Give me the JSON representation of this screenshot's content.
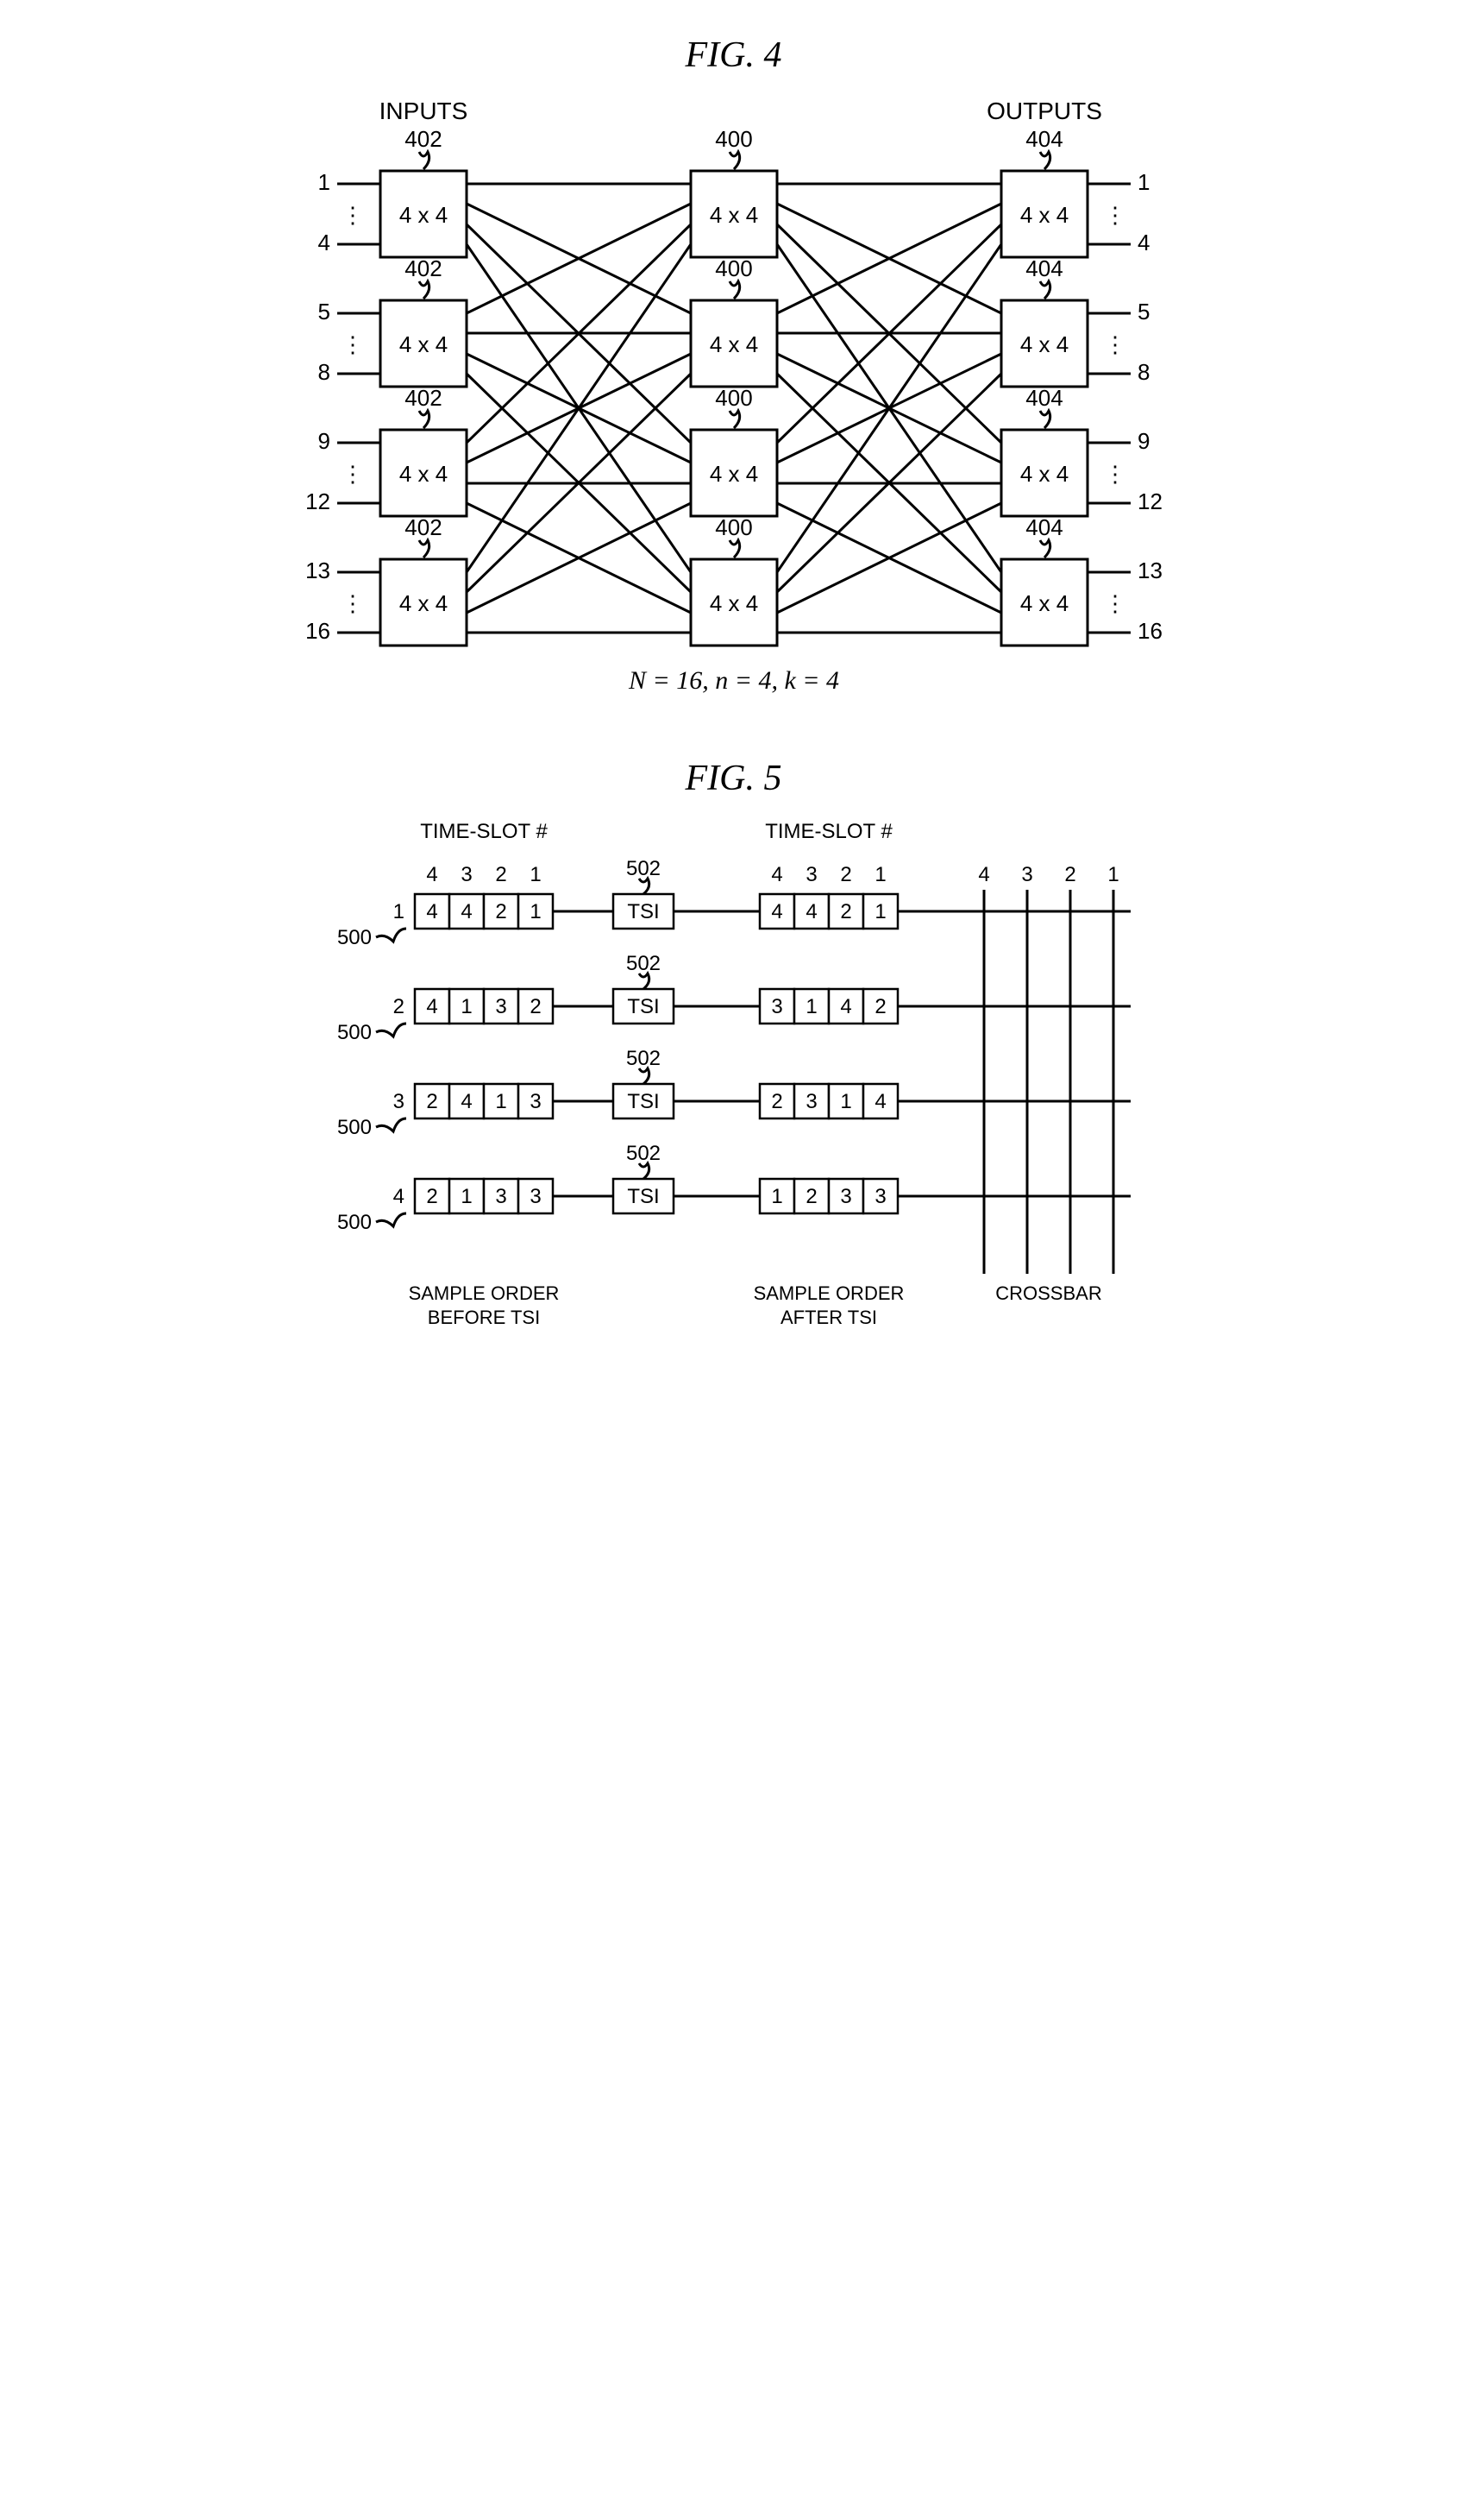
{
  "fig4": {
    "title": "FIG. 4",
    "inputs_label": "INPUTS",
    "outputs_label": "OUTPUTS",
    "ref_input": "402",
    "ref_middle": "400",
    "ref_output": "404",
    "box_label": "4 x 4",
    "caption": "N = 16,   n = 4,   k = 4",
    "left_ports": [
      {
        "top": "1",
        "bot": "4"
      },
      {
        "top": "5",
        "bot": "8"
      },
      {
        "top": "9",
        "bot": "12"
      },
      {
        "top": "13",
        "bot": "16"
      }
    ],
    "right_ports": [
      {
        "top": "1",
        "bot": "4"
      },
      {
        "top": "5",
        "bot": "8"
      },
      {
        "top": "9",
        "bot": "12"
      },
      {
        "top": "13",
        "bot": "16"
      }
    ]
  },
  "fig5": {
    "title": "FIG. 5",
    "ts_label": "TIME-SLOT #",
    "ts_header": [
      "4",
      "3",
      "2",
      "1"
    ],
    "ref_input": "500",
    "ref_tsi": "502",
    "tsi_label": "TSI",
    "crossbar_label": "CROSSBAR",
    "crossbar_header": [
      "4",
      "3",
      "2",
      "1"
    ],
    "before_label_l1": "SAMPLE ORDER",
    "before_label_l2": "BEFORE TSI",
    "after_label_l1": "SAMPLE ORDER",
    "after_label_l2": "AFTER TSI",
    "rows": [
      {
        "n": "1",
        "before": [
          "4",
          "4",
          "2",
          "1"
        ],
        "after": [
          "4",
          "4",
          "2",
          "1"
        ]
      },
      {
        "n": "2",
        "before": [
          "4",
          "1",
          "3",
          "2"
        ],
        "after": [
          "3",
          "1",
          "4",
          "2"
        ]
      },
      {
        "n": "3",
        "before": [
          "2",
          "4",
          "1",
          "3"
        ],
        "after": [
          "2",
          "3",
          "1",
          "4"
        ]
      },
      {
        "n": "4",
        "before": [
          "2",
          "1",
          "3",
          "3"
        ],
        "after": [
          "1",
          "2",
          "3",
          "3"
        ]
      }
    ]
  }
}
